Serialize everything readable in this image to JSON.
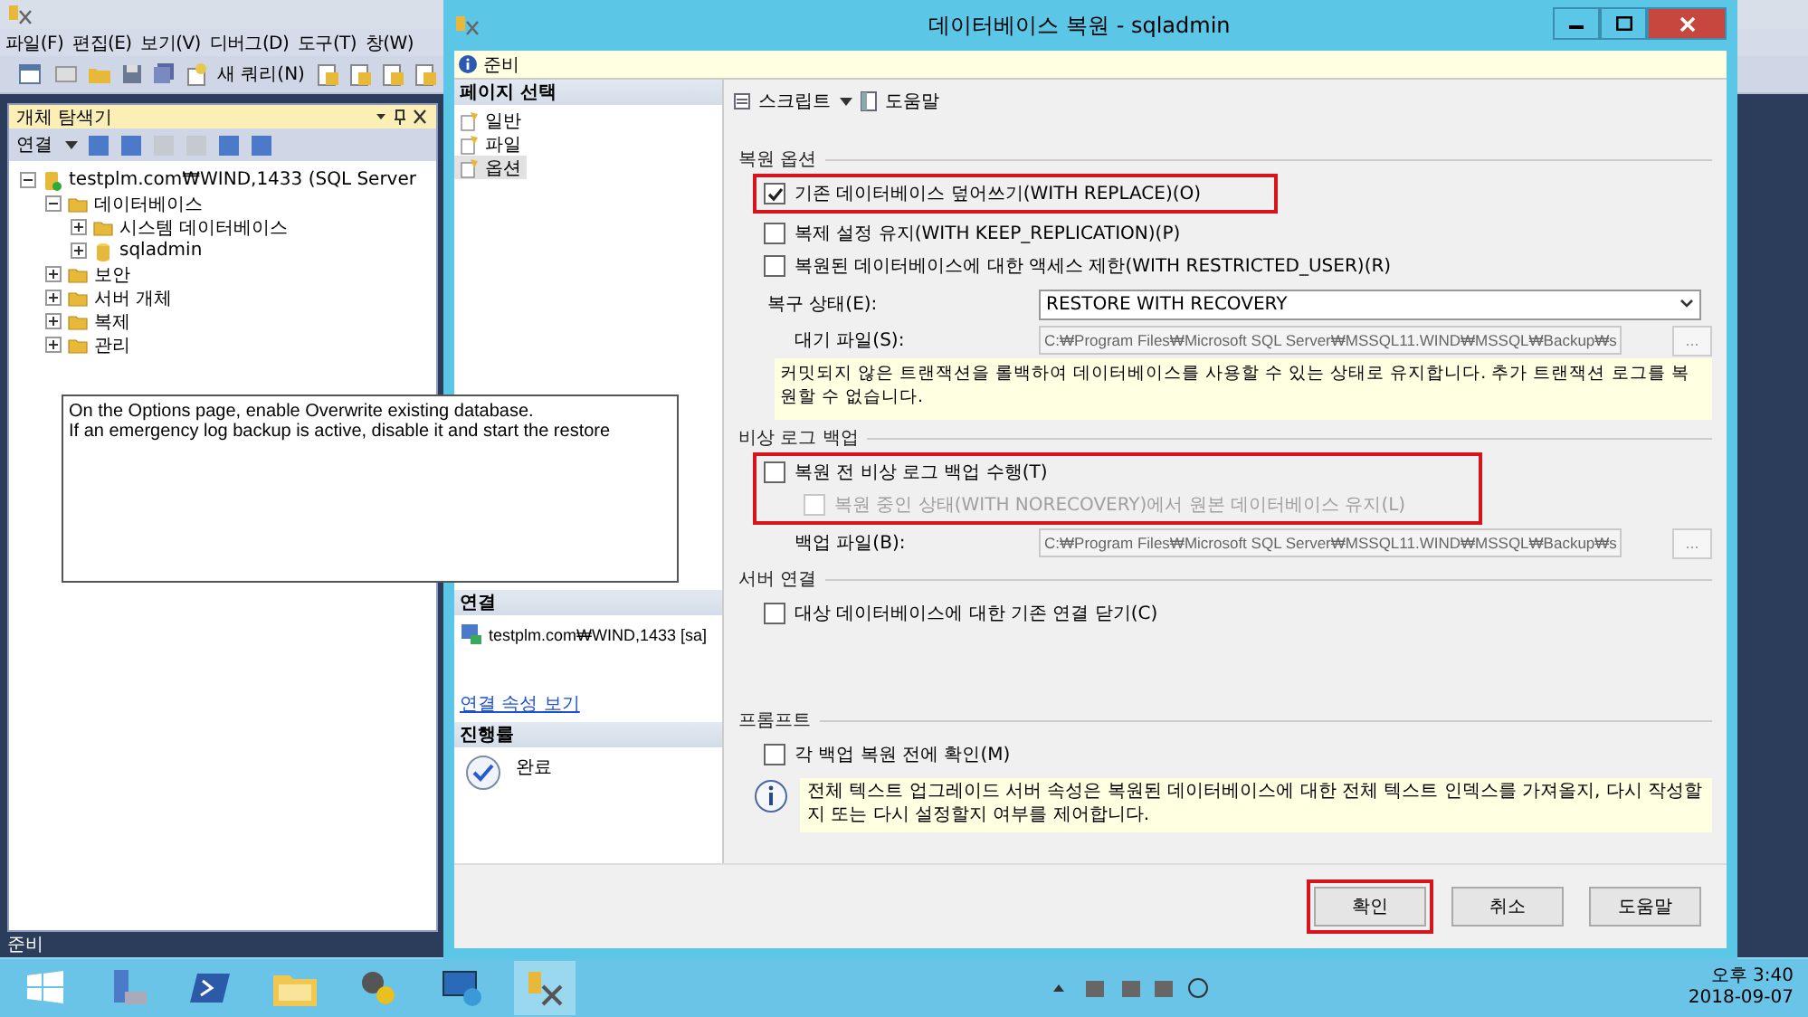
{
  "app": {
    "menu": [
      "파일(F)",
      "편집(E)",
      "보기(V)",
      "디버그(D)",
      "도구(T)",
      "창(W)"
    ],
    "toolbar": {
      "new_query": "새 쿼리(N)"
    },
    "object_explorer": {
      "title": "개체 탐색기",
      "connect": "연결",
      "tree": [
        {
          "label": "testplm.com₩WIND,1433 (SQL Server",
          "kind": "server",
          "expanded": true,
          "children": [
            {
              "label": "데이터베이스",
              "kind": "folder",
              "expanded": true,
              "children": [
                {
                  "label": "시스템 데이터베이스",
                  "kind": "folder",
                  "expanded": false
                },
                {
                  "label": "sqladmin",
                  "kind": "database",
                  "expanded": false
                }
              ]
            },
            {
              "label": "보안",
              "kind": "folder",
              "expanded": false
            },
            {
              "label": "서버 개체",
              "kind": "folder",
              "expanded": false
            },
            {
              "label": "복제",
              "kind": "folder",
              "expanded": false
            },
            {
              "label": "관리",
              "kind": "folder",
              "expanded": false
            }
          ]
        }
      ]
    },
    "status_bar": "준비"
  },
  "dialog": {
    "title": "데이터베이스 복원 - sqladmin",
    "status": "준비",
    "page_select": {
      "title": "페이지 선택",
      "items": [
        {
          "label": "일반",
          "selected": false
        },
        {
          "label": "파일",
          "selected": false
        },
        {
          "label": "옵션",
          "selected": true
        }
      ]
    },
    "connection": {
      "title": "연결",
      "server": "testplm.com₩WIND,1433 [sa]",
      "link": "연결 속성 보기"
    },
    "progress": {
      "title": "진행률",
      "state": "완료"
    },
    "toolbar": {
      "script": "스크립트",
      "help": "도움말"
    },
    "sections": [
      {
        "title": "복원 옵션",
        "rows": [
          {
            "kind": "checkbox",
            "label": "기존 데이터베이스 덮어쓰기(WITH REPLACE)(O)",
            "checked": true,
            "disabled": false,
            "highlighted": true
          },
          {
            "kind": "checkbox",
            "label": "복제 설정 유지(WITH KEEP_REPLICATION)(P)",
            "checked": false,
            "disabled": false,
            "highlighted": false
          },
          {
            "kind": "checkbox",
            "label": "복원된 데이터베이스에 대한 액세스 제한(WITH RESTRICTED_USER)(R)",
            "checked": false,
            "disabled": false,
            "highlighted": false
          },
          {
            "kind": "select",
            "label": "복구 상태(E):",
            "value": "RESTORE WITH RECOVERY"
          },
          {
            "kind": "file",
            "label": "대기 파일(S):",
            "value": "C:₩Program Files₩Microsoft SQL Server₩MSSQL11.WIND₩MSSQL₩Backup₩s",
            "browse": "...",
            "disabled": true
          },
          {
            "kind": "note",
            "text": "커밋되지 않은 트랜잭션을 롤백하여 데이터베이스를 사용할 수 있는 상태로 유지합니다. 추가 트랜잭션 로그를 복원할 수 없습니다."
          }
        ]
      },
      {
        "title": "비상 로그 백업",
        "rows": [
          {
            "kind": "checkbox",
            "label": "복원 전 비상 로그 백업 수행(T)",
            "checked": false,
            "disabled": false,
            "highlighted": true
          },
          {
            "kind": "subcheckbox",
            "label": "복원 중인 상태(WITH NORECOVERY)에서 원본 데이터베이스 유지(L)",
            "checked": false,
            "disabled": true,
            "highlighted": true
          },
          {
            "kind": "file",
            "label": "백업 파일(B):",
            "value": "C:₩Program Files₩Microsoft SQL Server₩MSSQL11.WIND₩MSSQL₩Backup₩s",
            "browse": "...",
            "disabled": true
          }
        ]
      },
      {
        "title": "서버 연결",
        "rows": [
          {
            "kind": "checkbox",
            "label": "대상 데이터베이스에 대한 기존 연결 닫기(C)",
            "checked": false,
            "disabled": false,
            "highlighted": false
          }
        ]
      },
      {
        "title": "프롬프트",
        "rows": [
          {
            "kind": "checkbox",
            "label": "각 백업 복원 전에 확인(M)",
            "checked": false,
            "disabled": false,
            "highlighted": false
          },
          {
            "kind": "info",
            "text": "전체 텍스트 업그레이드 서버 속성은 복원된 데이터베이스에 대한 전체 텍스트 인덱스를 가져올지, 다시 작성할지 또는 다시 설정할지 여부를 제어합니다."
          }
        ]
      }
    ],
    "buttons": [
      {
        "label": "확인",
        "highlighted": true
      },
      {
        "label": "취소",
        "highlighted": false
      },
      {
        "label": "도움말",
        "highlighted": false
      }
    ]
  },
  "note": {
    "lines": [
      "On the Options page, enable Overwrite existing database.",
      "If an emergency log backup is active, disable it and start the restore"
    ]
  },
  "taskbar": {
    "time": "오후 3:40",
    "date": "2018-09-07"
  }
}
